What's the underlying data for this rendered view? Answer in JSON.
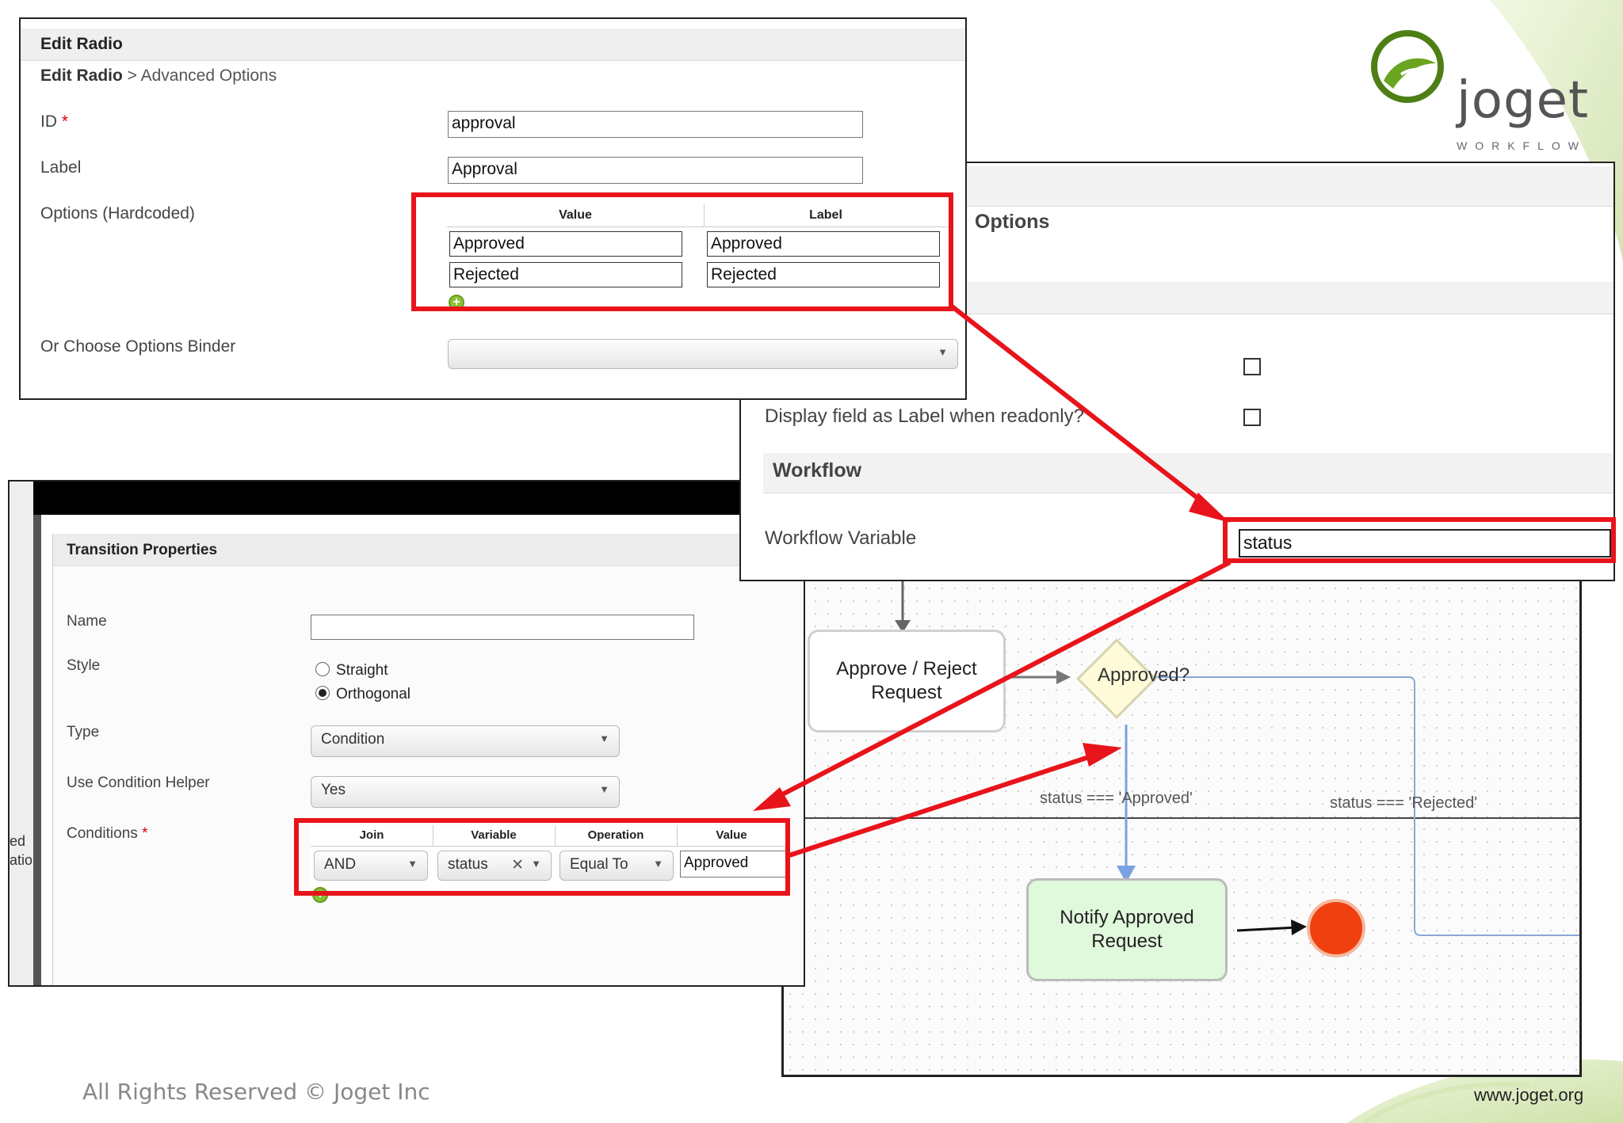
{
  "branding": {
    "logo_name": "joget",
    "logo_tagline": "WORKFLOW",
    "footer_copyright": "All Rights Reserved © Joget Inc",
    "footer_url": "www.joget.org",
    "brand_green": "#5a8a1e"
  },
  "edit_radio": {
    "title": "Edit Radio",
    "breadcrumb_current": "Edit Radio",
    "breadcrumb_rest": " > Advanced Options",
    "id_label": "ID",
    "id_required": "*",
    "id_value": "approval",
    "label_label": "Label",
    "label_value": "Approval",
    "options_label": "Options (Hardcoded)",
    "options_columns": [
      "Value",
      "Label"
    ],
    "options_rows": [
      {
        "value": "Approved",
        "label": "Approved"
      },
      {
        "value": "Rejected",
        "label": "Rejected"
      }
    ],
    "binder_label": "Or Choose Options Binder",
    "binder_value": ""
  },
  "advanced_panel": {
    "options_heading": "Options",
    "readonly_label_text": "Display field as Label when readonly?",
    "workflow_heading": "Workflow",
    "workflow_variable_label": "Workflow Variable",
    "workflow_variable_value": "status"
  },
  "transition": {
    "title": "Transition Properties",
    "name_label": "Name",
    "name_value": "",
    "style_label": "Style",
    "style_options": [
      "Straight",
      "Orthogonal"
    ],
    "style_selected": "Orthogonal",
    "type_label": "Type",
    "type_value": "Condition",
    "helper_label": "Use Condition Helper",
    "helper_value": "Yes",
    "conditions_label": "Conditions",
    "conditions_required": "*",
    "conditions_columns": [
      "Join",
      "Variable",
      "Operation",
      "Value"
    ],
    "condition_row": {
      "join": "AND",
      "variable": "status",
      "clear": "✕",
      "operation": "Equal To",
      "value": "Approved"
    },
    "left_clip_1": "ed",
    "left_clip_2": "atio"
  },
  "diagram": {
    "node_approve": "Approve / Reject\nRequest",
    "decision_label": "Approved?",
    "edge_approved": "status === 'Approved'",
    "edge_rejected": "status === 'Rejected'",
    "node_notify": "Notify Approved\nRequest",
    "end_color": "#f04010",
    "notify_bg": "#e0f8dc"
  },
  "highlight_color": "#e8141b"
}
